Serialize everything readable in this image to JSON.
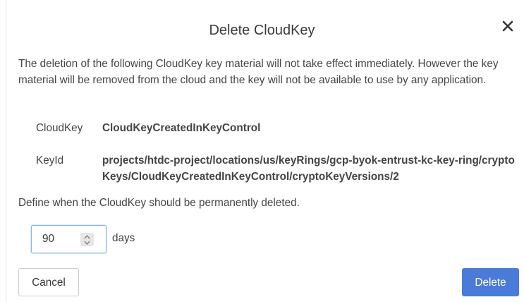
{
  "dialog": {
    "title": "Delete CloudKey",
    "close_glyph": "✕",
    "description": "The deletion of the following CloudKey key material will not take effect immediately. However the key material will be removed from the cloud and the key will not be available to use by any application.",
    "cloudkey_label": "CloudKey",
    "cloudkey_value": "CloudKeyCreatedInKeyControl",
    "keyid_label": "KeyId",
    "keyid_value": "projects/htdc-project/locations/us/keyRings/gcp-byok-entrust-kc-key-ring/cryptoKeys/CloudKeyCreatedInKeyControl/cryptoKeyVersions/2",
    "define_text": "Define when the CloudKey should be permanently deleted.",
    "days_input_value": "90",
    "days_unit": "days",
    "cancel_label": "Cancel",
    "delete_label": "Delete"
  },
  "colors": {
    "delete_button": "#4a7bd9",
    "input_focus_border": "#8ab4e8",
    "text": "#444444"
  },
  "icons": {
    "close": "close-icon",
    "spinner_up": "chevron-up-icon",
    "spinner_down": "chevron-down-icon"
  }
}
